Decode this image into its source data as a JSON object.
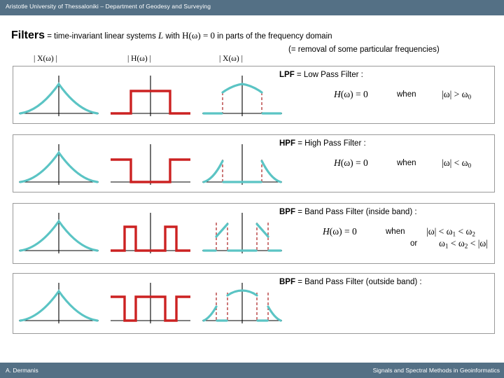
{
  "header": {
    "institution": "Aristotle University of Thessaloniki – Department of Geodesy and Surveying"
  },
  "footer": {
    "author": "A. Dermanis",
    "course": "Signals and Spectral Methods in Geoinformatics"
  },
  "title": {
    "keyword": "Filters",
    "definition_a": " = time-invariant linear systems ",
    "operator": "L",
    "definition_b": " with ",
    "condition": "H(ω) = 0",
    "definition_c": " in parts of the frequency domain",
    "note": "(= removal of some particular frequencies)"
  },
  "columns": {
    "input": "| X(ω) |",
    "transfer": "| H(ω) |",
    "output": "| X(ω) |"
  },
  "rows": [
    {
      "abbr": "LPF",
      "name": " = Low Pass Filter :",
      "equation": "H(ω) = 0",
      "when": "when",
      "condition": "|ω| > ω₀",
      "or": "",
      "condition2": ""
    },
    {
      "abbr": "HPF",
      "name": " = High Pass Filter :",
      "equation": "H(ω) = 0",
      "when": "when",
      "condition": "|ω| < ω₀",
      "or": "",
      "condition2": ""
    },
    {
      "abbr": "BPF",
      "name": " = Band Pass Filter (inside band) :",
      "equation": "H(ω) = 0",
      "when": "when",
      "condition": "|ω| < ω₁ < ω₂",
      "or": "or",
      "condition2": "ω₁ < ω₂ < |ω|"
    },
    {
      "abbr": "BPF",
      "name": " = Band Pass Filter (outside band) :",
      "equation": "",
      "when": "",
      "condition": "",
      "or": "",
      "condition2": ""
    }
  ],
  "colors": {
    "bar": "#547085",
    "signal": "#5BC4C4",
    "filter": "#CC2222",
    "axis": "#000000",
    "cutoff": "#B03030",
    "border": "#9a9a9a"
  },
  "chart_data": [
    {
      "type": "line",
      "name": "lpf-input-spectrum",
      "title": "| X(ω) |",
      "description": "Broad symmetric hump spectrum centered at 0",
      "x": [
        -4,
        -3,
        -2,
        -1,
        0,
        1,
        2,
        3,
        4
      ],
      "values": [
        0,
        0.25,
        0.62,
        0.92,
        1.0,
        0.92,
        0.62,
        0.25,
        0
      ]
    },
    {
      "type": "line",
      "name": "lpf-transfer",
      "title": "| H(ω) |",
      "description": "Ideal low pass: unity between -w0 and +w0, zero elsewhere",
      "x": [
        -4,
        -1.5,
        -1.5,
        1.5,
        1.5,
        4
      ],
      "values": [
        0,
        0,
        1,
        1,
        0,
        0
      ],
      "cutoffs": [
        -1.5,
        1.5
      ]
    },
    {
      "type": "line",
      "name": "lpf-output",
      "title": "| X(ω) |",
      "description": "Input hump truncated outside |w| > w0",
      "x": [
        -4,
        -1.5,
        -1.5,
        -1,
        0,
        1,
        1.5,
        1.5,
        4
      ],
      "values": [
        0,
        0,
        0.82,
        0.92,
        1.0,
        0.92,
        0.82,
        0,
        0
      ],
      "cutoffs": [
        -1.5,
        1.5
      ]
    },
    {
      "type": "line",
      "name": "hpf-input-spectrum",
      "title": "| X(ω) |",
      "description": "Broad symmetric hump spectrum centered at 0",
      "x": [
        -4,
        -3,
        -2,
        -1,
        0,
        1,
        2,
        3,
        4
      ],
      "values": [
        0,
        0.25,
        0.62,
        0.92,
        1.0,
        0.92,
        0.62,
        0.25,
        0
      ]
    },
    {
      "type": "line",
      "name": "hpf-transfer",
      "title": "| H(ω) |",
      "description": "Ideal high pass: zero between -w0 and +w0, unity elsewhere",
      "x": [
        -4,
        -1.5,
        -1.5,
        1.5,
        1.5,
        4
      ],
      "values": [
        1,
        1,
        0,
        0,
        1,
        1
      ],
      "cutoffs": [
        -1.5,
        1.5
      ]
    },
    {
      "type": "line",
      "name": "hpf-output",
      "title": "| X(ω) |",
      "description": "Input hump with central band removed",
      "x": [
        -4,
        -2.5,
        -1.5,
        -1.5,
        1.5,
        1.5,
        2.5,
        4
      ],
      "values": [
        0,
        0.45,
        0.78,
        0,
        0,
        0.78,
        0.45,
        0
      ],
      "cutoffs": [
        -1.5,
        1.5
      ]
    },
    {
      "type": "line",
      "name": "bpf-inside-input-spectrum",
      "title": "| X(ω) |",
      "description": "Broad symmetric hump spectrum centered at 0",
      "x": [
        -4,
        -3,
        -2,
        -1,
        0,
        1,
        2,
        3,
        4
      ],
      "values": [
        0,
        0.25,
        0.62,
        0.92,
        1.0,
        0.92,
        0.62,
        0.25,
        0
      ]
    },
    {
      "type": "line",
      "name": "bpf-inside-transfer",
      "title": "| H(ω) |",
      "description": "Two narrow pass bands at -w2..-w1 and w1..w2",
      "x": [
        -4,
        -2.4,
        -2.4,
        -1.4,
        -1.4,
        1.4,
        1.4,
        2.4,
        2.4,
        4
      ],
      "values": [
        0,
        0,
        1,
        1,
        0,
        0,
        1,
        1,
        0,
        0
      ],
      "cutoffs": [
        -2.4,
        -1.4,
        1.4,
        2.4
      ]
    },
    {
      "type": "line",
      "name": "bpf-inside-output",
      "title": "| X(ω) |",
      "description": "Only the two narrow bands of the input survive",
      "x": [
        -4,
        -2.4,
        -2.4,
        -1.4,
        -1.4,
        1.4,
        1.4,
        2.4,
        2.4,
        4
      ],
      "values": [
        0,
        0,
        0.48,
        0.74,
        0,
        0,
        0.74,
        0.48,
        0,
        0
      ],
      "cutoffs": [
        -2.4,
        -1.4,
        1.4,
        2.4
      ]
    },
    {
      "type": "line",
      "name": "bpf-outside-input-spectrum",
      "title": "| X(ω) |",
      "description": "Broad symmetric hump spectrum centered at 0",
      "x": [
        -4,
        -3,
        -2,
        -1,
        0,
        1,
        2,
        3,
        4
      ],
      "values": [
        0,
        0.25,
        0.62,
        0.92,
        1.0,
        0.92,
        0.62,
        0.25,
        0
      ]
    },
    {
      "type": "line",
      "name": "bpf-outside-transfer",
      "title": "| H(ω) |",
      "description": "Unity except two notch bands at -w2..-w1 and w1..w2",
      "x": [
        -4,
        -2.4,
        -2.4,
        -1.4,
        -1.4,
        1.4,
        1.4,
        2.4,
        2.4,
        4
      ],
      "values": [
        1,
        1,
        0,
        0,
        1,
        1,
        0,
        0,
        1,
        1
      ],
      "cutoffs": [
        -2.4,
        -1.4,
        1.4,
        2.4
      ]
    },
    {
      "type": "line",
      "name": "bpf-outside-output",
      "title": "| X(ω) |",
      "description": "Input hump with two notch bands removed",
      "x": [
        -4,
        -2.4,
        -2.4,
        -1.4,
        -1.4,
        0,
        1.4,
        1.4,
        2.4,
        2.4,
        4
      ],
      "values": [
        0,
        0.48,
        0,
        0,
        0.74,
        1.0,
        0.74,
        0,
        0,
        0.48,
        0
      ],
      "cutoffs": [
        -2.4,
        -1.4,
        1.4,
        2.4
      ]
    }
  ]
}
